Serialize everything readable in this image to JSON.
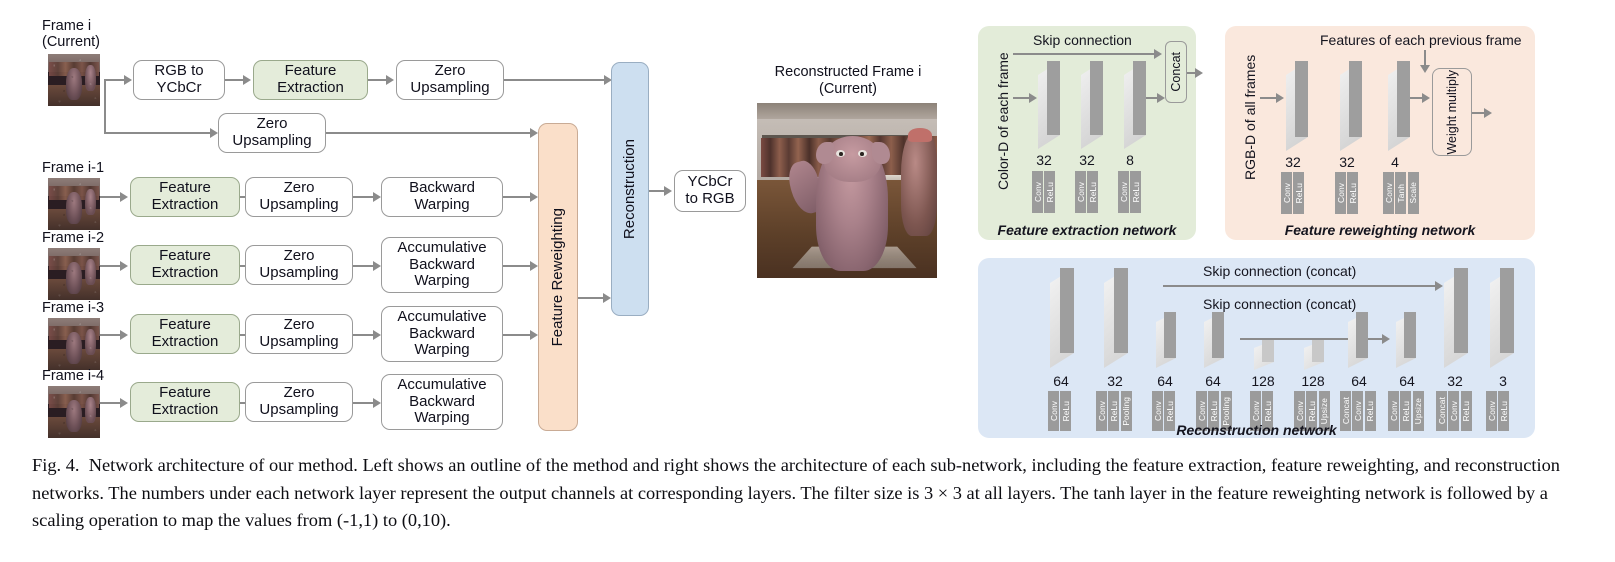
{
  "figure": {
    "caption_label": "Fig. 4.",
    "caption_text": "Network architecture of our method. Left shows an outline of the method and right shows the architecture of each sub-network, including the feature extraction, feature reweighting, and reconstruction networks. The numbers under each network layer represent the output channels at corresponding layers. The filter size is 3 × 3 at all layers. The tanh layer in the feature reweighting network is followed by a scaling operation to map the values from (-1,1) to (0,10)."
  },
  "left_outline": {
    "frames": [
      {
        "label_line1": "Frame i",
        "label_line2": "(Current)"
      },
      {
        "label_line1": "Frame i-1",
        "label_line2": ""
      },
      {
        "label_line1": "Frame i-2",
        "label_line2": ""
      },
      {
        "label_line1": "Frame i-3",
        "label_line2": ""
      },
      {
        "label_line1": "Frame i-4",
        "label_line2": ""
      }
    ],
    "blocks": {
      "rgb_to_ycbcr": "RGB to\nYCbCr",
      "feature_extraction": "Feature\nExtraction",
      "zero_upsampling": "Zero\nUpsampling",
      "backward_warping": "Backward\nWarping",
      "accumulative_backward_warping": "Accumulative\nBackward\nWarping",
      "feature_reweighting": "Feature Reweighting",
      "reconstruction": "Reconstruction",
      "ycbcr_to_rgb": "YCbCr\nto RGB"
    },
    "output": {
      "title_line1": "Reconstructed Frame i",
      "title_line2": "(Current)"
    }
  },
  "sub_networks": [
    {
      "id": "feature-extraction-network",
      "title": "Feature extraction network",
      "panel_color": "#e3ecd9",
      "input_label": "Color-D of each frame",
      "top_label": "Skip connection",
      "end_block": "Concat",
      "layers": [
        {
          "channels": "32",
          "ops": [
            "Conv",
            "ReLu"
          ]
        },
        {
          "channels": "32",
          "ops": [
            "Conv",
            "ReLu"
          ]
        },
        {
          "channels": "8",
          "ops": [
            "Conv",
            "ReLu"
          ]
        }
      ]
    },
    {
      "id": "feature-reweighting-network",
      "title": "Feature reweighting network",
      "panel_color": "#fae8dd",
      "input_label": "RGB-D of all frames",
      "top_label": "Features of each previous frame",
      "end_block": "Weight multiply",
      "layers": [
        {
          "channels": "32",
          "ops": [
            "Conv",
            "ReLu"
          ]
        },
        {
          "channels": "32",
          "ops": [
            "Conv",
            "ReLu"
          ]
        },
        {
          "channels": "4",
          "ops": [
            "Conv",
            "Tanh",
            "Scale"
          ]
        }
      ]
    },
    {
      "id": "reconstruction-network",
      "title": "Reconstruction network",
      "panel_color": "#dce7f5",
      "skip_labels": [
        "Skip connection (concat)",
        "Skip connection (concat)"
      ],
      "layers": [
        {
          "channels": "64",
          "ops": [
            "Conv",
            "ReLu"
          ]
        },
        {
          "channels": "32",
          "ops": [
            "Conv",
            "ReLu",
            "Pooling"
          ]
        },
        {
          "channels": "64",
          "ops": [
            "Conv",
            "ReLu"
          ]
        },
        {
          "channels": "64",
          "ops": [
            "Conv",
            "ReLu",
            "Pooling"
          ]
        },
        {
          "channels": "128",
          "ops": [
            "Conv",
            "ReLu"
          ]
        },
        {
          "channels": "128",
          "ops": [
            "Conv",
            "ReLu",
            "Upsize"
          ]
        },
        {
          "channels": "64",
          "ops": [
            "Concat",
            "Conv",
            "ReLu"
          ]
        },
        {
          "channels": "64",
          "ops": [
            "Conv",
            "ReLu",
            "Upsize"
          ]
        },
        {
          "channels": "32",
          "ops": [
            "Concat",
            "Conv",
            "ReLu"
          ]
        },
        {
          "channels": "3",
          "ops": [
            "Conv",
            "ReLu"
          ]
        }
      ]
    }
  ]
}
